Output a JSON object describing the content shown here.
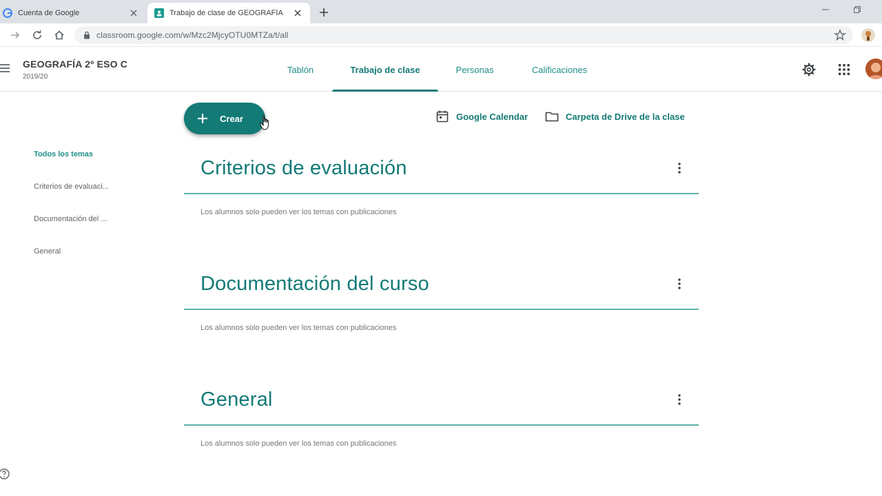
{
  "browser": {
    "tabs": [
      {
        "title": "Cuenta de Google",
        "icon": "google-favicon",
        "active": false
      },
      {
        "title": "Trabajo de clase de GEOGRAFÍA",
        "icon": "classroom-favicon",
        "active": true
      }
    ],
    "url": "classroom.google.com/w/Mzc2MjcyOTU0MTZa/t/all"
  },
  "header": {
    "class_name": "GEOGRAFÍA 2º ESO C",
    "class_year": "2019/20",
    "tabs": [
      {
        "label": "Tablón",
        "active": false
      },
      {
        "label": "Trabajo de clase",
        "active": true
      },
      {
        "label": "Personas",
        "active": false
      },
      {
        "label": "Calificaciones",
        "active": false
      }
    ]
  },
  "sidebar": {
    "items": [
      {
        "label": "Todos los temas",
        "active": true
      },
      {
        "label": "Criterios de evaluaci...",
        "active": false
      },
      {
        "label": "Documentación del ...",
        "active": false
      },
      {
        "label": "General",
        "active": false
      }
    ]
  },
  "actions": {
    "create_label": "Crear",
    "calendar_label": "Google Calendar",
    "drive_label": "Carpeta de Drive de la clase"
  },
  "topics": [
    {
      "title": "Criterios de evaluación",
      "note": "Los alumnos solo pueden ver los temas con publicaciones"
    },
    {
      "title": "Documentación del curso",
      "note": "Los alumnos solo pueden ver los temas con publicaciones"
    },
    {
      "title": "General",
      "note": "Los alumnos solo pueden ver los temas con publicaciones"
    }
  ],
  "colors": {
    "accent": "#137a76",
    "accent_light": "#1e8e8a",
    "divider": "#5fb1ac"
  }
}
